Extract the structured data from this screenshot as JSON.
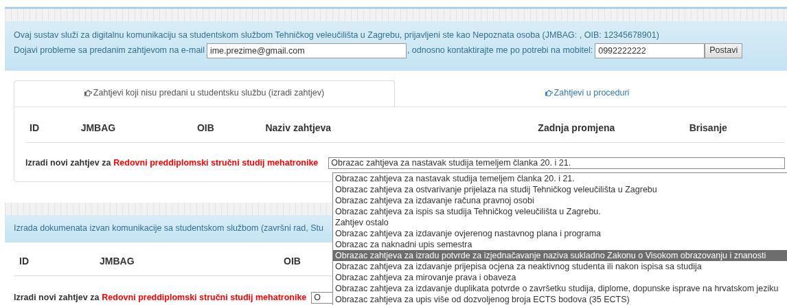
{
  "info_panel": {
    "line_1": "Ovaj sustav služi za digitalnu komunikaciju sa studentskom službom Tehničkog veleučilišta u Zagrebu, prijavljeni ste kao Nepoznata osoba (JMBAG: , OIB: 12345678901)",
    "email_label": "Dojavi probleme sa predanim zahtjevom na e-mail",
    "email_value": "ime.prezime@gmail.com",
    "phone_label": ", odnosno kontaktirajte me po potrebi na mobitel:",
    "phone_value": "0992222222",
    "button": "Postavi"
  },
  "tabs": [
    {
      "label": "Zahtjevi koji nisu predani u studentsku službu (izradi zahtjev)",
      "selected": true
    },
    {
      "label": "Zahtjevi u proceduri",
      "selected": false
    }
  ],
  "table": {
    "columns": [
      "ID",
      "JMBAG",
      "OIB",
      "Naziv zahtjeva",
      "Zadnja promjena",
      "Brisanje"
    ],
    "new_label": "Izradi novi zahtjev za",
    "program": "Redovni preddiplomski stručni studij mehatronike",
    "select_value": "Obrazac zahtjeva za nastavak studija temeljem članka 20. i 21."
  },
  "dropdown": [
    {
      "label": "Obrazac zahtjeva za nastavak studija temeljem članka 20. i 21.",
      "selected": false
    },
    {
      "label": "Obrazac zahtjeva za ostvarivanje prijelaza na studij Tehničkog veleučilišta u Zagrebu",
      "selected": false
    },
    {
      "label": "Obrazac zahtjeva za izdavanje računa pravnoj osobi",
      "selected": false
    },
    {
      "label": "Obrazac zahtjeva za ispis sa studija Tehničkog veleučilišta u Zagrebu.",
      "selected": false
    },
    {
      "label": "Zahtjev ostalo",
      "selected": false
    },
    {
      "label": "Obrazac zahtjeva za izdavanje ovjerenog nastavnog plana i programa",
      "selected": false
    },
    {
      "label": "Obrazac za naknadni upis semestra",
      "selected": false
    },
    {
      "label": "Obrazac zahtjeva za izradu potvrde za izjednačavanje naziva sukladno Zakonu o Visokom obrazovanju i znanosti",
      "selected": true
    },
    {
      "label": "Obrazac zahtjeva za izdavanje prijepisa ocjena za neaktivnog studenta ili nakon ispisa sa studija",
      "selected": false
    },
    {
      "label": "Obrazac zahtjeva za mirovanje prava i obaveza",
      "selected": false
    },
    {
      "label": "Obrazac zahtjeva za izdavanje duplikata potvrde o završetku studija, diplome, dopunske isprave na hrvatskom jeziku",
      "selected": false
    },
    {
      "label": "Obrazac zahtjeva za upis više od dozvoljenog broja ECTS bodova (35 ECTS)",
      "selected": false
    }
  ],
  "second_section": {
    "info": "Izrada dokumenata izvan komunikacije sa studentskom službom (završni rad, Stu",
    "columns": [
      "ID",
      "JMBAG",
      "OIB"
    ],
    "new_label": "Izradi novi zahtjev za",
    "program": "Redovni preddiplomski stručni studij mehatronike",
    "select_value": "O"
  }
}
